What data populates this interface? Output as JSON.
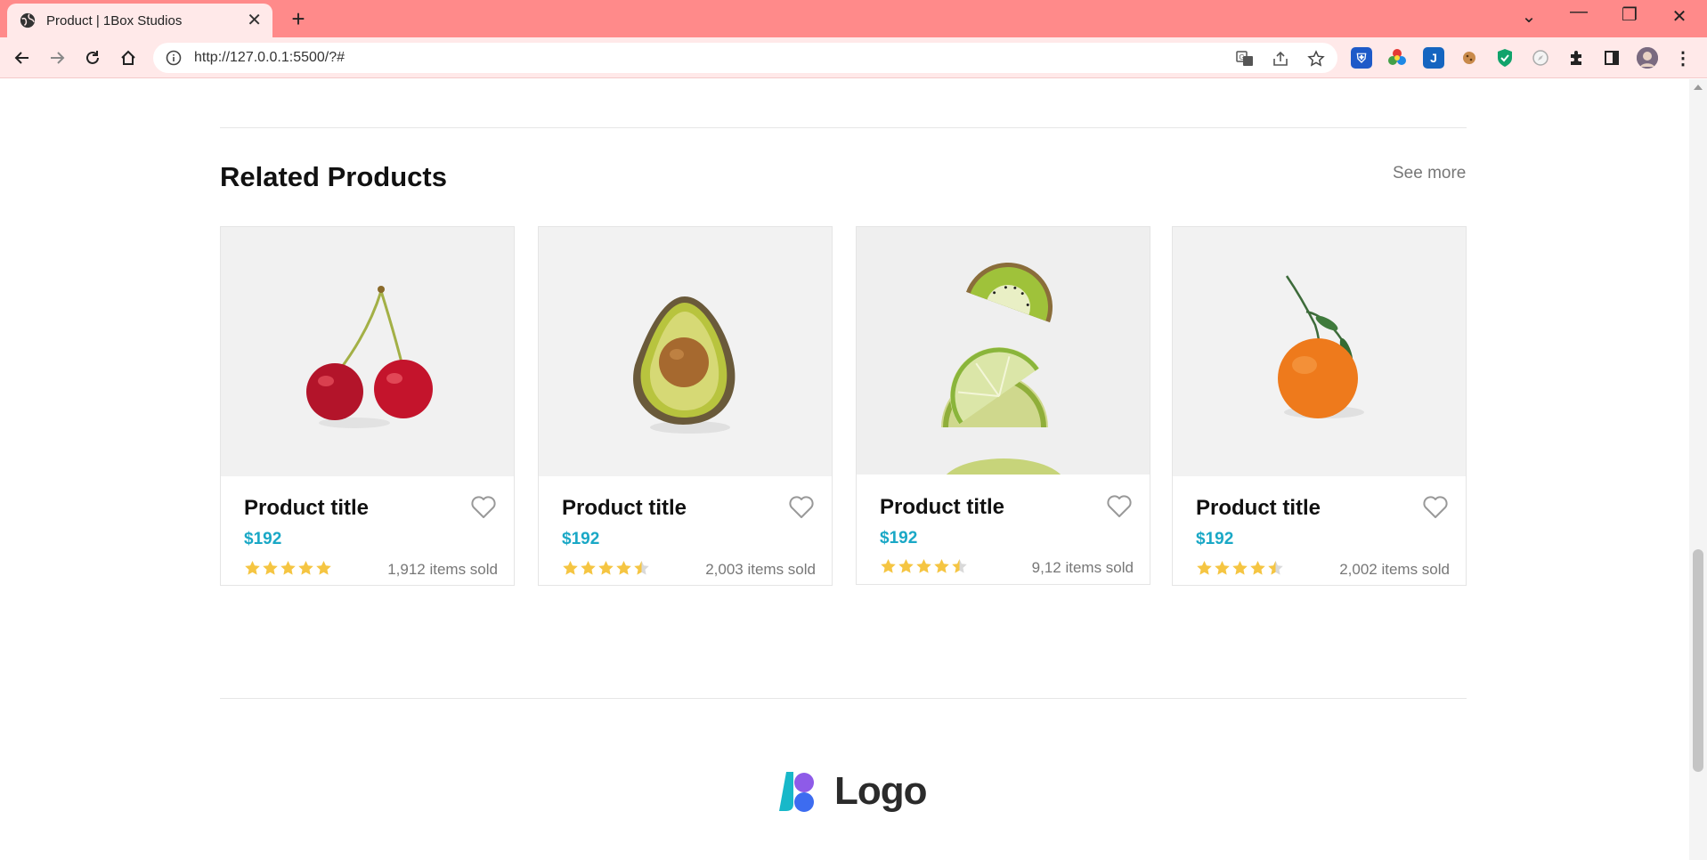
{
  "browser": {
    "tab_title": "Product | 1Box Studios",
    "url": "http://127.0.0.1:5500/?#",
    "accent_color": "#ff8a8a"
  },
  "page": {
    "section_title": "Related Products",
    "see_more": "See more",
    "logo_text": "Logo",
    "price_color": "#1aa8c6",
    "star_color": "#f5c542"
  },
  "products": [
    {
      "title": "Product title",
      "price": "$192",
      "rating": 5,
      "sold": "1,912 items sold",
      "image": "cherries"
    },
    {
      "title": "Product title",
      "price": "$192",
      "rating": 4.5,
      "sold": "2,003 items sold",
      "image": "avocado"
    },
    {
      "title": "Product title",
      "price": "$192",
      "rating": 4.5,
      "sold": "9,12 items sold",
      "image": "kiwi-lime"
    },
    {
      "title": "Product title",
      "price": "$192",
      "rating": 4.5,
      "sold": "2,002 items sold",
      "image": "tangerine"
    }
  ]
}
